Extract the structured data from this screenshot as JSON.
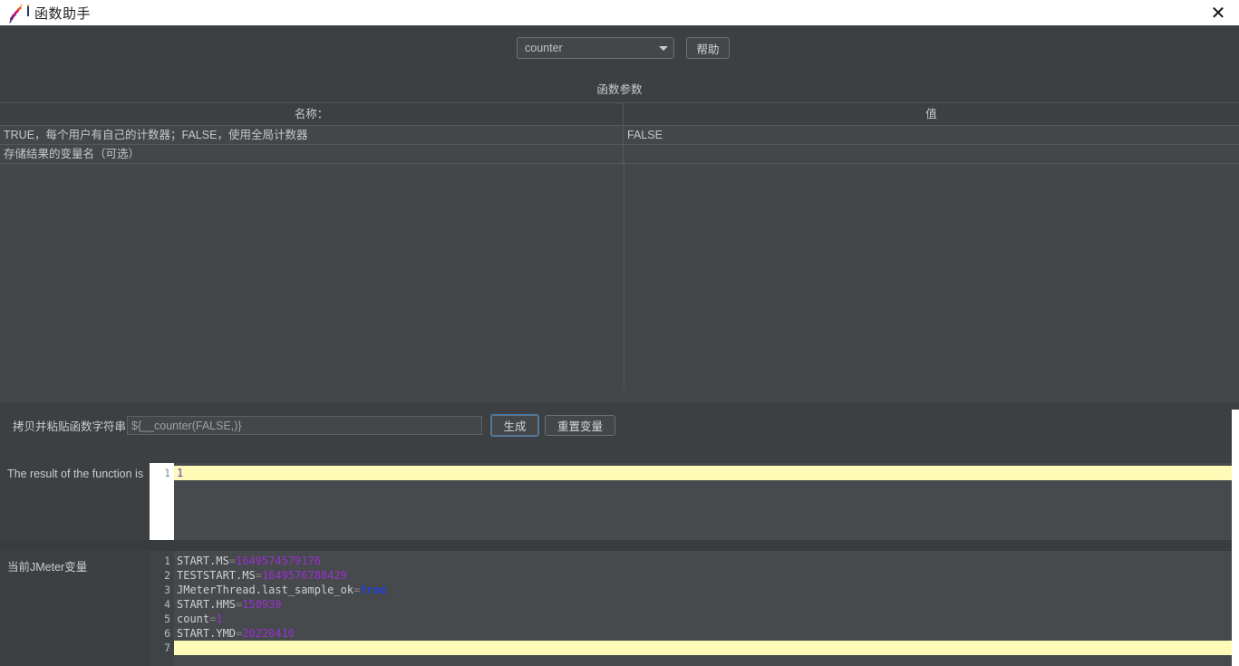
{
  "titlebar": {
    "title": "函数助手",
    "icon": "jmeter-feather-icon",
    "close_label": "✕"
  },
  "toolbar": {
    "function_select_value": "counter",
    "function_select_icon": "chevron-down-icon",
    "help_label": "帮助"
  },
  "parameters": {
    "section_title": "函数参数",
    "columns": [
      "名称：",
      "值"
    ],
    "rows": [
      {
        "name": "TRUE，每个用户有自己的计数器；FALSE，使用全局计数器",
        "value": "FALSE"
      },
      {
        "name": "存储结果的变量名（可选）",
        "value": ""
      }
    ]
  },
  "copy_row": {
    "label": "拷贝并粘贴函数字符串",
    "input_value": "${__counter(FALSE,)}",
    "generate_label": "生成",
    "reset_label": "重置变量"
  },
  "result": {
    "label": "The result of the function is",
    "lines": [
      {
        "no": "1",
        "text": "1"
      }
    ]
  },
  "variables": {
    "label": "当前JMeter变量",
    "lines": [
      {
        "no": "1",
        "name": "START.MS",
        "eq": "=",
        "value": "1649574579176",
        "type": "num"
      },
      {
        "no": "2",
        "name": "TESTSTART.MS",
        "eq": "=",
        "value": "1649576788429",
        "type": "num"
      },
      {
        "no": "3",
        "name": "JMeterThread.last_sample_ok",
        "eq": "=",
        "value": "true",
        "type": "bool"
      },
      {
        "no": "4",
        "name": "START.HMS",
        "eq": "=",
        "value": "150939",
        "type": "num"
      },
      {
        "no": "5",
        "name": "count",
        "eq": "=",
        "value": "1",
        "type": "num"
      },
      {
        "no": "6",
        "name": "START.YMD",
        "eq": "=",
        "value": "20220410",
        "type": "num"
      },
      {
        "no": "7",
        "name": "",
        "eq": "",
        "value": "",
        "type": "empty"
      }
    ]
  },
  "colors": {
    "window_bg": "#3c4043",
    "panel_bg": "#43474a",
    "focus_blue": "#3d7fbf",
    "highlight_yellow": "#fdfbb5",
    "value_purple": "#9b2fd0",
    "bool_blue": "#1f3fd8"
  }
}
